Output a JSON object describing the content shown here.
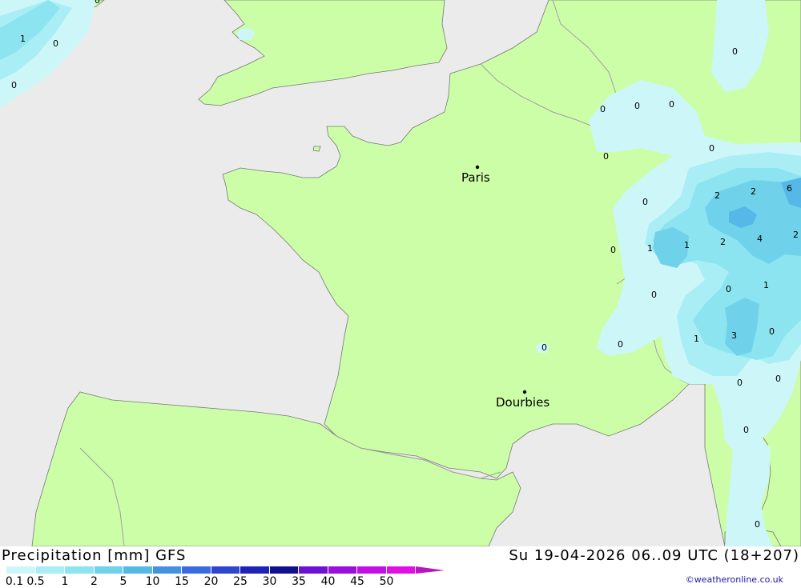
{
  "map": {
    "cities": [
      {
        "id": "paris",
        "name": "Paris"
      },
      {
        "id": "dourbies",
        "name": "Dourbies"
      }
    ],
    "values": [
      "0",
      "1",
      "0",
      "0",
      "0",
      "0",
      "0",
      "0",
      "0",
      "0",
      "2",
      "2",
      "6",
      "2",
      "4",
      "2",
      "0",
      "1",
      "1",
      "0",
      "0",
      "1",
      "0",
      "3",
      "1",
      "0",
      "0",
      "0",
      "0",
      "0",
      "0",
      "0"
    ]
  },
  "footer": {
    "title": "Precipitation [mm] GFS",
    "datetime": "Su 19-04-2026 06..09 UTC (18+207)",
    "credit": "©weatheronline.co.uk"
  },
  "legend": {
    "labels": [
      "0.1",
      "0.5",
      "1",
      "2",
      "5",
      "10",
      "15",
      "20",
      "25",
      "30",
      "35",
      "40",
      "45",
      "50"
    ],
    "colors": [
      "#cdf6f9",
      "#a9eef4",
      "#8be4ef",
      "#6fd2ea",
      "#55b8e6",
      "#4391e0",
      "#3a6ae0",
      "#2e45d0",
      "#1e22b8",
      "#11118f",
      "#6b12d6",
      "#9a0fe0",
      "#c20fe8",
      "#e00fe6",
      "#b816c0"
    ]
  },
  "colors": {
    "land": "#ccfea8",
    "sea": "#ebebeb",
    "border": "#a0a0a0",
    "coast": "#666666"
  }
}
